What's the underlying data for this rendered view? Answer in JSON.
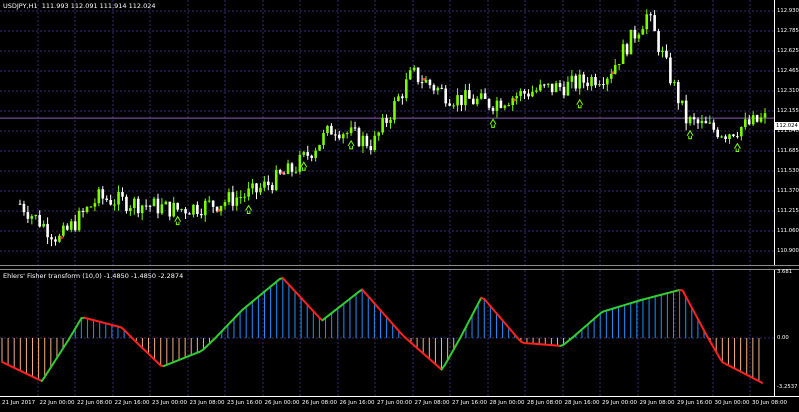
{
  "main_chart": {
    "title": "USDJPY,H1  111.993 112.091 111.914 112.024",
    "symbol": "USDJPY,H1",
    "ohlc": {
      "open": 111.993,
      "high": 112.091,
      "low": 111.914,
      "close": 112.024
    },
    "current_price_label": "112.024",
    "price_ticks": [
      "112.930",
      "112.785",
      "112.625",
      "112.465",
      "112.310",
      "112.155",
      "111.840",
      "111.685",
      "111.530",
      "111.370",
      "111.215",
      "111.060",
      "110.900"
    ],
    "colors": {
      "bull": "#7CFC00",
      "bear": "#ffffff",
      "grid": "#3a2a6a",
      "arrow": "#7CFC00",
      "dot": "#ff3030",
      "current_line": "#8a5cb8"
    }
  },
  "indicator": {
    "title": "Ehlers' Fisher transform (10,0) -1.4850 -1.4850 -2.2874",
    "scale_labels": [
      "3.681",
      "0.00",
      "-3.2537"
    ],
    "colors": {
      "positive_histogram": "#1e90ff",
      "negative_histogram": "#f4b183",
      "rising_line": "#32cd32",
      "falling_line": "#ff2020"
    }
  },
  "time_axis": [
    "21 Jun 2017",
    "22 Jun 00:00",
    "22 Jun 08:00",
    "22 Jun 16:00",
    "23 Jun 00:00",
    "23 Jun 08:00",
    "23 Jun 16:00",
    "26 Jun 00:00",
    "26 Jun 08:00",
    "26 Jun 16:00",
    "27 Jun 00:00",
    "27 Jun 08:00",
    "27 Jun 16:00",
    "28 Jun 00:00",
    "28 Jun 08:00",
    "28 Jun 16:00",
    "29 Jun 00:00",
    "29 Jun 08:00",
    "29 Jun 16:00",
    "30 Jun 00:00",
    "30 Jun 08:00"
  ],
  "chart_data": [
    {
      "type": "line",
      "title": "USDJPY,H1",
      "x": [
        "22 Jun 00:00",
        "22 Jun 08:00",
        "22 Jun 16:00",
        "23 Jun 00:00",
        "23 Jun 08:00",
        "23 Jun 16:00",
        "26 Jun 00:00",
        "26 Jun 08:00",
        "26 Jun 16:00",
        "27 Jun 00:00",
        "27 Jun 08:00",
        "27 Jun 16:00",
        "28 Jun 00:00",
        "28 Jun 08:00",
        "28 Jun 16:00",
        "29 Jun 00:00",
        "29 Jun 08:00",
        "29 Jun 16:00",
        "30 Jun 00:00",
        "30 Jun 08:00"
      ],
      "series": [
        {
          "name": "USDJPY,H1",
          "values": [
            111.3,
            111.0,
            111.35,
            111.3,
            111.25,
            111.3,
            111.4,
            111.6,
            111.95,
            111.8,
            112.4,
            112.2,
            112.15,
            112.25,
            112.3,
            112.4,
            112.9,
            112.0,
            111.9,
            112.02
          ]
        }
      ],
      "ylim": [
        110.9,
        113.0
      ]
    },
    {
      "type": "line",
      "title": "Ehlers' Fisher transform (10,0)",
      "x": [
        "22 Jun 00:00",
        "22 Jun 08:00",
        "22 Jun 16:00",
        "23 Jun 00:00",
        "23 Jun 08:00",
        "23 Jun 16:00",
        "26 Jun 00:00",
        "26 Jun 08:00",
        "26 Jun 16:00",
        "27 Jun 00:00",
        "27 Jun 08:00",
        "27 Jun 16:00",
        "28 Jun 00:00",
        "28 Jun 08:00",
        "28 Jun 16:00",
        "29 Jun 00:00",
        "29 Jun 08:00",
        "29 Jun 16:00",
        "30 Jun 00:00",
        "30 Jun 08:00"
      ],
      "series": [
        {
          "name": "Ehlers' Fisher transform",
          "values": [
            -1.5,
            -2.7,
            1.2,
            0.6,
            -1.8,
            -0.8,
            1.6,
            3.5,
            1.0,
            2.8,
            0.2,
            -2.0,
            2.4,
            -0.3,
            -0.5,
            1.5,
            2.2,
            2.8,
            -1.5,
            -2.8
          ]
        }
      ],
      "ylim": [
        -3.2537,
        3.681
      ]
    }
  ]
}
